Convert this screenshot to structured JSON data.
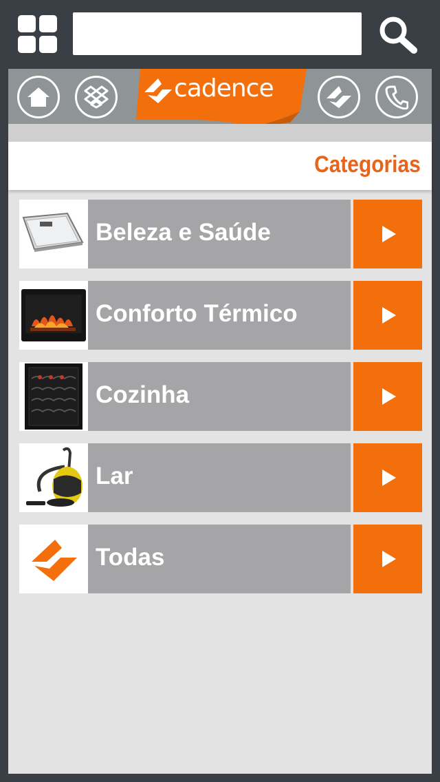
{
  "search": {
    "value": "",
    "placeholder": ""
  },
  "brand": {
    "name": "cadence",
    "color": "#f36f0b"
  },
  "nav": {
    "icons": [
      "home-icon",
      "dropbox-icon",
      "cadence-logo-icon",
      "phone-icon"
    ]
  },
  "header": {
    "title": "Categorias",
    "title_color": "#e8641b"
  },
  "categories": [
    {
      "label": "Beleza e Saúde",
      "thumb": "bathroom-scale"
    },
    {
      "label": "Conforto Térmico",
      "thumb": "electric-fireplace"
    },
    {
      "label": "Cozinha",
      "thumb": "wine-cooler"
    },
    {
      "label": "Lar",
      "thumb": "vacuum-cleaner"
    },
    {
      "label": "Todas",
      "thumb": "cadence-logo"
    }
  ],
  "colors": {
    "topbar": "#3a3f45",
    "nav": "#8f9496",
    "row": "#a5a4a6",
    "arrow": "#f36f0b"
  }
}
